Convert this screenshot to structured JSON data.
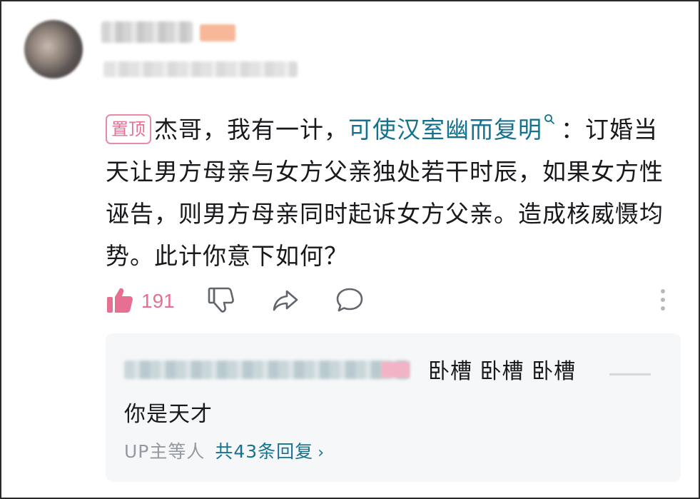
{
  "comment": {
    "pin_tag": "置顶",
    "text_before_link": "杰哥，我有一计，",
    "link_text": "可使汉室幽而复明",
    "text_after_link": "：订婚当天让男方母亲与女方父亲独处若干时辰，如果女方性诬告，则男方母亲同时起诉女方父亲。造成核威慑均势。此计你意下如何？"
  },
  "actions": {
    "like_count": "191",
    "like_color": "#e66f92"
  },
  "reply_preview": {
    "first_line": "卧槽  卧槽   卧槽",
    "second_line": "你是天才",
    "footer_prefix": "UP主等人",
    "reply_count_text": "共43条回复",
    "chevron": "›"
  },
  "colors": {
    "accent_link": "#14728e",
    "pin_pink": "#e66f92",
    "muted": "#9499a0"
  },
  "icons": [
    "thumbs-up-icon",
    "thumbs-down-icon",
    "share-icon",
    "comment-icon",
    "more-icon",
    "search-icon"
  ]
}
